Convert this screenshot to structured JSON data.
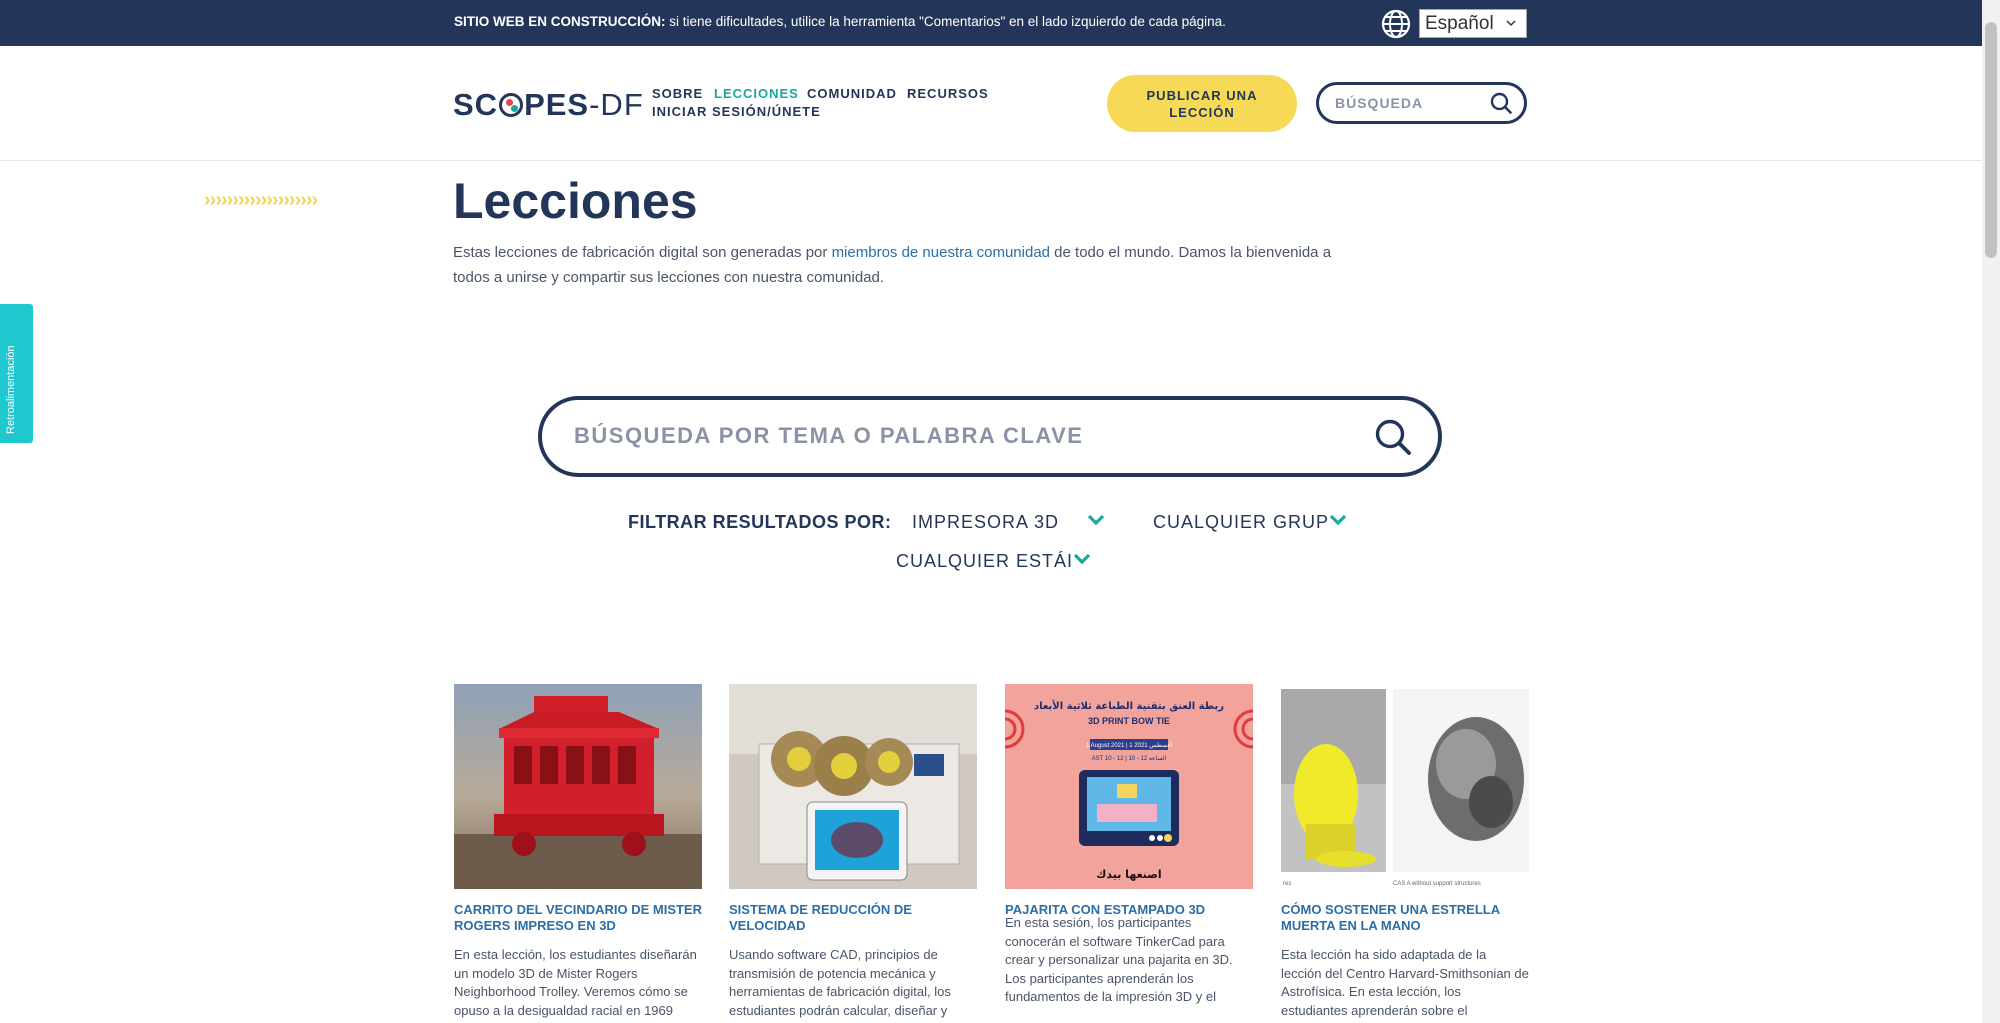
{
  "banner": {
    "bold": "SITIO WEB EN CONSTRUCCIÓN:",
    "text": " si tiene dificultades, utilice la herramienta \"Comentarios\" en el lado izquierdo de cada página.",
    "language": "Español"
  },
  "header": {
    "logo_main": "SC",
    "logo_mid": "PES",
    "logo_df": "-DF",
    "nav": [
      "SOBRE",
      "LECCIONES",
      "COMUNIDAD",
      "RECURSOS",
      "INICIAR SESIÓN/ÚNETE"
    ],
    "publish_line1": "PUBLICAR UNA",
    "publish_line2": "LECCIÓN",
    "search_placeholder": "BÚSQUEDA"
  },
  "feedback": "Retroalimentación",
  "main": {
    "chevrons": "››››››››››››››››››››",
    "title": "Lecciones",
    "intro_before": "Estas lecciones de fabricación digital son generadas por ",
    "intro_link": "miembros de nuestra comunidad",
    "intro_after": " de todo el mundo. Damos la bienvenida a todos a unirse y compartir sus lecciones con nuestra comunidad.",
    "search_placeholder": "BÚSQUEDA POR TEMA O PALABRA CLAVE",
    "filter_label": "FILTRAR RESULTADOS POR:",
    "filters": [
      "IMPRESORA 3D",
      "CUALQUIER GRUP",
      "CUALQUIER ESTÁI"
    ]
  },
  "cards": [
    {
      "title": "CARRITO DEL VECINDARIO DE MISTER ROGERS IMPRESO EN 3D",
      "desc": "En esta lección, los estudiantes diseñarán un modelo 3D de Mister Rogers Neighborhood Trolley. Veremos cómo se opuso a la desigualdad racial en 1969"
    },
    {
      "title": "SISTEMA DE REDUCCIÓN DE VELOCIDAD",
      "desc": "Usando software CAD, principios de transmisión de potencia mecánica y herramientas de fabricación digital, los estudiantes podrán calcular, diseñar y"
    },
    {
      "title": "PAJARITA CON ESTAMPADO 3D",
      "desc": "En esta sesión, los participantes conocerán el software TinkerCad para crear y personalizar una pajarita en 3D. Los participantes aprenderán los fundamentos de la impresión 3D y el",
      "img_arabic_top": "ربطة العنق بتقنية الطباعة ثلاثية الأبعاد",
      "img_english": "3D PRINT BOW TIE",
      "img_date1": "1 August 2021",
      "img_date2": "1 أغسطس 2021",
      "img_time": "AST 10 - 12 | 10 - 12 الساعة",
      "img_arabic_bottom": "اصنعها بيدك"
    },
    {
      "title": "CÓMO SOSTENER UNA ESTRELLA MUERTA EN LA MANO",
      "desc": "Esta lección ha sido adaptada de la lección del Centro Harvard-Smithsonian de Astrofísica. En esta lección, los estudiantes aprenderán sobre el",
      "img_caption_left": "res",
      "img_caption_right": "CAS A without support structures"
    }
  ],
  "colors": {
    "navy": "#233659",
    "teal": "#1aa89c",
    "yellow": "#f6d957",
    "link": "#2c6ea6",
    "feedback": "#1fc7cf"
  }
}
